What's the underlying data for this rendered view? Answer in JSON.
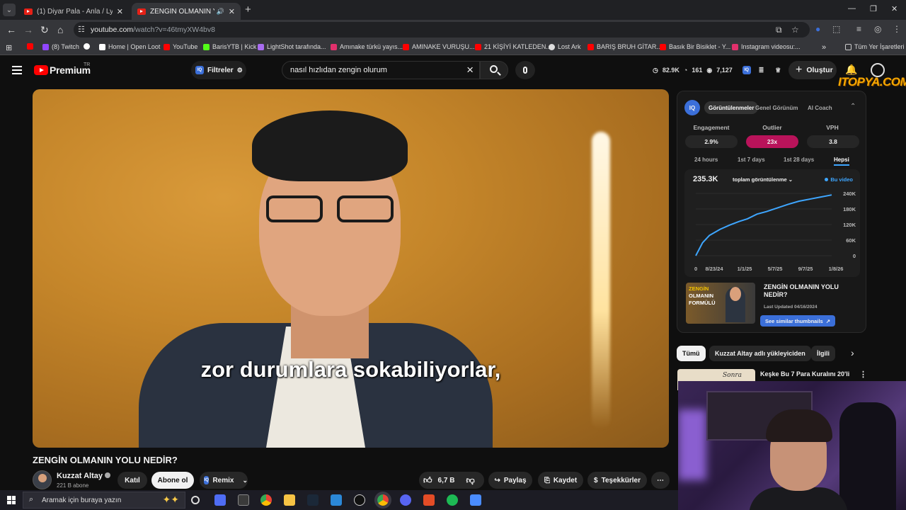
{
  "browser": {
    "tabs": [
      {
        "title": "(1) Diyar Pala - Anla / Lyrics - S",
        "active": false
      },
      {
        "title": "ZENGİN OLMANIN YOLU N",
        "active": true
      }
    ],
    "url_domain": "youtube.com",
    "url_path": "/watch?v=46tmyXW4bv8",
    "bookmarks": [
      {
        "label": "(8) Twitch",
        "color": "#9146ff"
      },
      {
        "label": "Home | Open Loot",
        "color": "#ffffff"
      },
      {
        "label": "YouTube",
        "color": "#ff0000"
      },
      {
        "label": "BarisYTB | Kick",
        "color": "#53fc18"
      },
      {
        "label": "LightShot tarafında...",
        "color": "#a86cf0"
      },
      {
        "label": "Amınake türkü yayıs...",
        "color": "#e1306c"
      },
      {
        "label": "AMINAKE VURUŞU...",
        "color": "#ff0000"
      },
      {
        "label": "21 KİŞİYİ KATLEDEN...",
        "color": "#ff0000"
      },
      {
        "label": "Lost Ark",
        "color": "#dddddd"
      },
      {
        "label": "BARIŞ BRUH GİTAR...",
        "color": "#ff0000"
      },
      {
        "label": "Basık Bir Bisiklet - Y...",
        "color": "#ff0000"
      },
      {
        "label": "Instagram videosu:...",
        "color": "#e1306c"
      }
    ],
    "all_bookmarks": "Tüm Yer İşaretleri"
  },
  "header": {
    "brand": "Premium",
    "region": "TR",
    "filters_label": "Filtreler",
    "search_value": "nasıl hızlıdan zengin olurum",
    "stats": [
      "82.9K",
      "161",
      "7,127"
    ],
    "create_label": "Oluştur",
    "watermark": "ITOPYA.COM"
  },
  "video": {
    "subtitle": "zor durumlara sokabiliyorlar,",
    "title": "ZENGİN OLMANIN YOLU NEDİR?",
    "channel_name": "Kuzzat Altay",
    "subscribers": "221 B abone",
    "join_label": "Katıl",
    "subscribe_label": "Abone ol",
    "remix_label": "Remix",
    "like_count": "6,7 B",
    "share_label": "Paylaş",
    "save_label": "Kaydet",
    "thanks_label": "Teşekkürler"
  },
  "iq_panel": {
    "logo": "IQ",
    "tabs": [
      "Görüntülenmeler",
      "Genel Görünüm",
      "AI Coach"
    ],
    "metrics": [
      {
        "label": "Engagement",
        "value": "2.9%"
      },
      {
        "label": "Outlier",
        "value": "23x"
      },
      {
        "label": "VPH",
        "value": "3.8"
      }
    ],
    "ranges": [
      "24 hours",
      "1st 7 days",
      "1st 28 days",
      "Hepsi"
    ],
    "total_views": "235.3K",
    "views_dropdown": "toplam görüntülenme",
    "legend": "Bu video",
    "card_thumb_lines": [
      "ZENGİN",
      "OLMANIN",
      "FORMÜLÜ"
    ],
    "card_title": "ZENGİN OLMANIN YOLU NEDİR?",
    "card_updated": "Last Updated 04/16/2024",
    "similar_label": "See similar thumbnails"
  },
  "chart_data": {
    "type": "line",
    "x_ticks": [
      "0",
      "8/23/24",
      "1/1/25",
      "5/7/25",
      "9/7/25",
      "1/8/26"
    ],
    "y_ticks": [
      "240K",
      "180K",
      "120K",
      "60K",
      "0"
    ],
    "ylim": [
      0,
      240000
    ],
    "series": [
      {
        "name": "Bu video",
        "x": [
          0,
          0.05,
          0.1,
          0.18,
          0.25,
          0.32,
          0.38,
          0.45,
          0.52,
          0.6,
          0.68,
          0.76,
          0.84,
          0.92,
          1.0
        ],
        "y": [
          0,
          50000,
          78000,
          102000,
          118000,
          132000,
          142000,
          160000,
          170000,
          184000,
          198000,
          210000,
          218000,
          226000,
          234000
        ]
      }
    ]
  },
  "related": {
    "chips": [
      "Tümü",
      "Kuzzat Altay adlı yükleyiciden",
      "İlgili"
    ],
    "first_title": "Keşke Bu 7 Para Kuralını 20'li",
    "first_thumb_text": "Sonra"
  },
  "taskbar": {
    "search_placeholder": "Aramak için buraya yazın"
  }
}
